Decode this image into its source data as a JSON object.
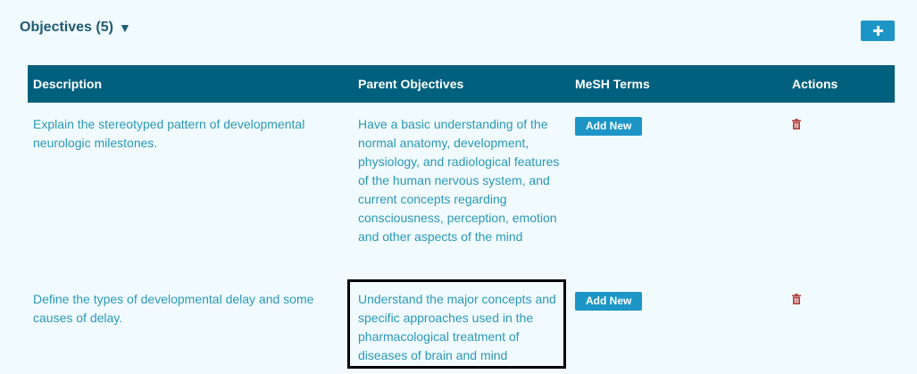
{
  "section": {
    "title": "Objectives (5)",
    "caret": "▼",
    "add_icon": "plus-icon"
  },
  "table": {
    "headers": {
      "description": "Description",
      "parent": "Parent Objectives",
      "mesh": "MeSH Terms",
      "actions": "Actions"
    },
    "rows": [
      {
        "description": "Explain the stereotyped pattern of developmental neurologic milestones.",
        "parent": "Have a basic understanding of the normal anatomy, development, physiology, and radiological features of the human nervous system, and current concepts regarding consciousness, perception, emotion and other aspects of the mind",
        "mesh_button": "Add New",
        "action_icon": "trash-icon"
      },
      {
        "description": "Define the types of developmental delay and some causes of delay.",
        "parent": "Understand the major concepts and specific approaches used in the pharmacological treatment of diseases of brain and mind",
        "mesh_button": "Add New",
        "action_icon": "trash-icon"
      }
    ]
  },
  "colors": {
    "header_bg": "#00607d",
    "link_text": "#2a98b6",
    "button": "#1d96c7",
    "trash": "#b03a3a",
    "page_bg": "#f1fbfe"
  }
}
